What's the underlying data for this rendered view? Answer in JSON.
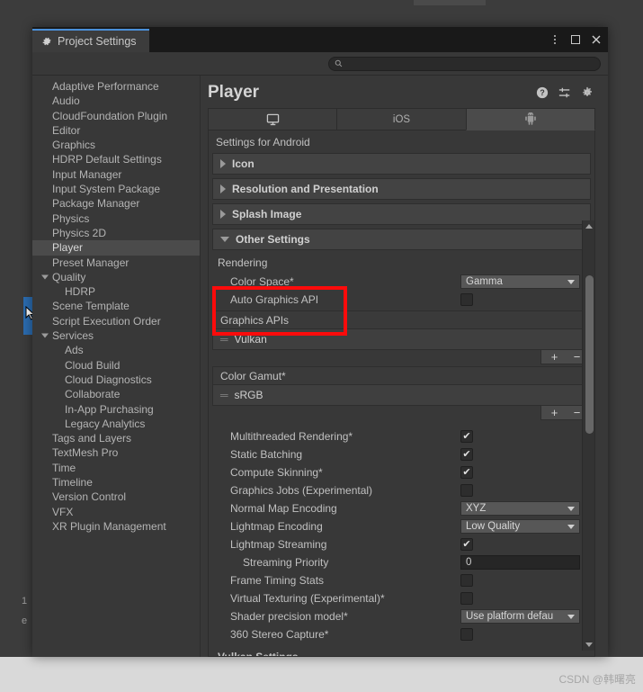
{
  "window": {
    "tab_title": "Project Settings",
    "tab_icon": "gear-icon",
    "controls": {
      "menu": "kebab-menu-icon",
      "maximize": "maximize-icon",
      "close": "close-icon"
    }
  },
  "search": {
    "placeholder": "",
    "value": "",
    "icon": "search-icon"
  },
  "sidebar": {
    "items": [
      {
        "label": "Adaptive Performance",
        "level": 0,
        "selected": false,
        "expandable": false
      },
      {
        "label": "Audio",
        "level": 0,
        "selected": false,
        "expandable": false
      },
      {
        "label": "CloudFoundation Plugin",
        "level": 0,
        "selected": false,
        "expandable": false
      },
      {
        "label": "Editor",
        "level": 0,
        "selected": false,
        "expandable": false
      },
      {
        "label": "Graphics",
        "level": 0,
        "selected": false,
        "expandable": false
      },
      {
        "label": "HDRP Default Settings",
        "level": 0,
        "selected": false,
        "expandable": false
      },
      {
        "label": "Input Manager",
        "level": 0,
        "selected": false,
        "expandable": false
      },
      {
        "label": "Input System Package",
        "level": 0,
        "selected": false,
        "expandable": false
      },
      {
        "label": "Package Manager",
        "level": 0,
        "selected": false,
        "expandable": false
      },
      {
        "label": "Physics",
        "level": 0,
        "selected": false,
        "expandable": false
      },
      {
        "label": "Physics 2D",
        "level": 0,
        "selected": false,
        "expandable": false
      },
      {
        "label": "Player",
        "level": 0,
        "selected": true,
        "expandable": false
      },
      {
        "label": "Preset Manager",
        "level": 0,
        "selected": false,
        "expandable": false
      },
      {
        "label": "Quality",
        "level": 0,
        "selected": false,
        "expandable": true
      },
      {
        "label": "HDRP",
        "level": 1,
        "selected": false,
        "expandable": false
      },
      {
        "label": "Scene Template",
        "level": 0,
        "selected": false,
        "expandable": false
      },
      {
        "label": "Script Execution Order",
        "level": 0,
        "selected": false,
        "expandable": false
      },
      {
        "label": "Services",
        "level": 0,
        "selected": false,
        "expandable": true
      },
      {
        "label": "Ads",
        "level": 1,
        "selected": false,
        "expandable": false
      },
      {
        "label": "Cloud Build",
        "level": 1,
        "selected": false,
        "expandable": false
      },
      {
        "label": "Cloud Diagnostics",
        "level": 1,
        "selected": false,
        "expandable": false
      },
      {
        "label": "Collaborate",
        "level": 1,
        "selected": false,
        "expandable": false
      },
      {
        "label": "In-App Purchasing",
        "level": 1,
        "selected": false,
        "expandable": false
      },
      {
        "label": "Legacy Analytics",
        "level": 1,
        "selected": false,
        "expandable": false
      },
      {
        "label": "Tags and Layers",
        "level": 0,
        "selected": false,
        "expandable": false
      },
      {
        "label": "TextMesh Pro",
        "level": 0,
        "selected": false,
        "expandable": false
      },
      {
        "label": "Time",
        "level": 0,
        "selected": false,
        "expandable": false
      },
      {
        "label": "Timeline",
        "level": 0,
        "selected": false,
        "expandable": false
      },
      {
        "label": "Version Control",
        "level": 0,
        "selected": false,
        "expandable": false
      },
      {
        "label": "VFX",
        "level": 0,
        "selected": false,
        "expandable": false
      },
      {
        "label": "XR Plugin Management",
        "level": 0,
        "selected": false,
        "expandable": false
      }
    ]
  },
  "main": {
    "title": "Player",
    "header_icons": [
      "help-icon",
      "preset-icon",
      "gear-icon"
    ],
    "platform_tabs": [
      {
        "icon": "desktop-monitor-icon",
        "label": "",
        "selected": false
      },
      {
        "icon": "",
        "label": "iOS",
        "selected": false
      },
      {
        "icon": "android-robot-icon",
        "label": "",
        "selected": true
      }
    ],
    "settings_for": "Settings for Android",
    "foldouts": [
      {
        "label": "Icon",
        "expanded": false
      },
      {
        "label": "Resolution and Presentation",
        "expanded": false
      },
      {
        "label": "Splash Image",
        "expanded": false
      },
      {
        "label": "Other Settings",
        "expanded": true
      }
    ],
    "rendering_group_label": "Rendering",
    "rows": [
      {
        "name": "Color Space*",
        "type": "dropdown",
        "value": "Gamma"
      },
      {
        "name": "Auto Graphics API",
        "type": "checkbox",
        "value": false
      }
    ],
    "graphics_apis_list": {
      "header": "Graphics APIs",
      "items": [
        "Vulkan"
      ],
      "add_label": "+",
      "remove_label": "−"
    },
    "color_gamut_list": {
      "header": "Color Gamut*",
      "items": [
        "sRGB"
      ],
      "add_label": "+",
      "remove_label": "−"
    },
    "rows_lower": [
      {
        "name": "Multithreaded Rendering*",
        "type": "checkbox",
        "value": true,
        "indent": false
      },
      {
        "name": "Static Batching",
        "type": "checkbox",
        "value": true,
        "indent": false
      },
      {
        "name": "Compute Skinning*",
        "type": "checkbox",
        "value": true,
        "indent": false
      },
      {
        "name": "Graphics Jobs (Experimental)",
        "type": "checkbox",
        "value": false,
        "indent": false
      },
      {
        "name": "Normal Map Encoding",
        "type": "dropdown",
        "value": "XYZ",
        "indent": false
      },
      {
        "name": "Lightmap Encoding",
        "type": "dropdown",
        "value": "Low Quality",
        "indent": false
      },
      {
        "name": "Lightmap Streaming",
        "type": "checkbox",
        "value": true,
        "indent": false
      },
      {
        "name": "Streaming Priority",
        "type": "number",
        "value": "0",
        "indent": true
      },
      {
        "name": "Frame Timing Stats",
        "type": "checkbox",
        "value": false,
        "indent": false
      },
      {
        "name": "Virtual Texturing (Experimental)*",
        "type": "checkbox",
        "value": false,
        "indent": false
      },
      {
        "name": "Shader precision model*",
        "type": "dropdown",
        "value": "Use platform defau",
        "indent": false
      },
      {
        "name": "360 Stereo Capture*",
        "type": "checkbox",
        "value": false,
        "indent": false
      }
    ],
    "vulkan_settings_label": "Vulkan Settings"
  },
  "highlight": {
    "color": "#fc0b0b",
    "target": "Graphics APIs / Vulkan"
  },
  "watermark": {
    "text": "CSDN @韩曙亮"
  }
}
